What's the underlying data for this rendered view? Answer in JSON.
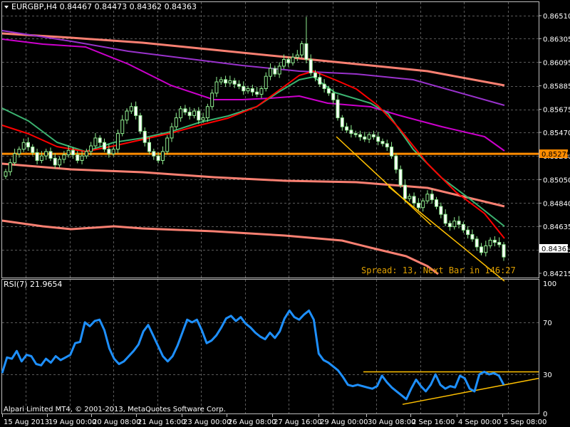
{
  "window": {
    "symbol_menu_icon": "triangle-down-icon",
    "price_header": "EURGBP,H4  0.84467 0.84473 0.84362 0.84363",
    "rsi_header": "RSI(7) 21.9654",
    "copyright": "Alpari Limited MT4, © 2001-2013, MetaQuotes Software Corp.",
    "spread_text": "Spread: 13, Next Bar in 146:27",
    "current_price_label": "0.84363",
    "level_price_label": "0.85279"
  },
  "colors": {
    "background": "#000000",
    "grid": "#5a5a5a",
    "candle": "#90ee90",
    "rsi_line": "#1e90ff",
    "ma_red": "#ff0000",
    "ma_green": "#3cb371",
    "ma_magenta": "#cc00cc",
    "ma_purple": "#9932cc",
    "band_salmon": "#fa8072",
    "level_orange": "#ff8c00",
    "trend_yellow": "#ffc000"
  },
  "chart_data": [
    {
      "type": "candlestick",
      "title": "EURGBP,H4",
      "y_ticks": [
        0.8651,
        0.86305,
        0.86095,
        0.85885,
        0.85675,
        0.8547,
        0.8526,
        0.8505,
        0.8484,
        0.84635,
        0.84425,
        0.84215
      ],
      "ylim": [
        0.84215,
        0.866
      ],
      "horizontal_level": 0.85279,
      "last_price": 0.84363,
      "x_ticks": [
        "15 Aug 2013",
        "19 Aug 00:00",
        "20 Aug 08:00",
        "21 Aug 16:00",
        "23 Aug 00:00",
        "26 Aug 08:00",
        "27 Aug 16:00",
        "29 Aug 00:00",
        "30 Aug 08:00",
        "2 Sep 16:00",
        "4 Sep 00:00",
        "5 Sep 08:00"
      ],
      "closes": [
        0.8512,
        0.852,
        0.8528,
        0.8532,
        0.8538,
        0.8534,
        0.8529,
        0.8522,
        0.8526,
        0.853,
        0.8524,
        0.8518,
        0.8523,
        0.8527,
        0.8531,
        0.8527,
        0.8522,
        0.8526,
        0.853,
        0.8535,
        0.8542,
        0.8538,
        0.8532,
        0.8528,
        0.8532,
        0.8546,
        0.8558,
        0.8566,
        0.857,
        0.8562,
        0.8548,
        0.8538,
        0.853,
        0.8526,
        0.8522,
        0.853,
        0.8542,
        0.8552,
        0.856,
        0.8568,
        0.8565,
        0.8562,
        0.8566,
        0.8558,
        0.856,
        0.857,
        0.8582,
        0.8592,
        0.8594,
        0.8591,
        0.8593,
        0.859,
        0.8588,
        0.8584,
        0.8586,
        0.8583,
        0.8581,
        0.8586,
        0.8597,
        0.8604,
        0.8599,
        0.8606,
        0.8612,
        0.8609,
        0.8614,
        0.8616,
        0.8626,
        0.8612,
        0.86,
        0.8596,
        0.859,
        0.8586,
        0.8582,
        0.8576,
        0.856,
        0.8552,
        0.8549,
        0.8546,
        0.8545,
        0.8543,
        0.8541,
        0.8545,
        0.8543,
        0.8539,
        0.8537,
        0.8534,
        0.8526,
        0.8514,
        0.85,
        0.8488,
        0.849,
        0.8484,
        0.848,
        0.8486,
        0.8492,
        0.8487,
        0.8481,
        0.8474,
        0.8466,
        0.8463,
        0.8468,
        0.8465,
        0.846,
        0.8456,
        0.8452,
        0.8445,
        0.844,
        0.8446,
        0.8451,
        0.8449,
        0.8447,
        0.8436
      ],
      "indicators": [
        "moving averages (red, green, magenta, purple)",
        "envelope bands (salmon)",
        "trend lines (yellow)"
      ]
    },
    {
      "type": "line",
      "title": "RSI(7) 21.9654",
      "ylim": [
        0,
        100
      ],
      "y_ticks": [
        100,
        70,
        30,
        0
      ],
      "values": [
        31,
        43,
        42,
        48,
        40,
        45,
        44,
        38,
        37,
        42,
        39,
        44,
        41,
        43,
        45,
        54,
        55,
        70,
        67,
        71,
        72,
        64,
        50,
        42,
        38,
        40,
        44,
        48,
        53,
        63,
        68,
        60,
        52,
        44,
        40,
        44,
        52,
        62,
        72,
        70,
        72,
        64,
        54,
        56,
        60,
        66,
        73,
        75,
        71,
        74,
        69,
        66,
        62,
        59,
        57,
        62,
        58,
        63,
        73,
        79,
        74,
        72,
        76,
        79,
        72,
        46,
        41,
        39,
        36,
        33,
        28,
        22,
        21,
        22,
        21,
        20,
        19,
        21,
        29,
        24,
        20,
        17,
        14,
        11,
        19,
        26,
        21,
        17,
        22,
        30,
        22,
        19,
        21,
        20,
        29,
        27,
        19,
        17,
        30,
        32,
        30,
        31,
        29,
        22
      ],
      "upper_trend_level": 32,
      "lower_trend_start": 7,
      "lower_trend_end": 27
    }
  ]
}
